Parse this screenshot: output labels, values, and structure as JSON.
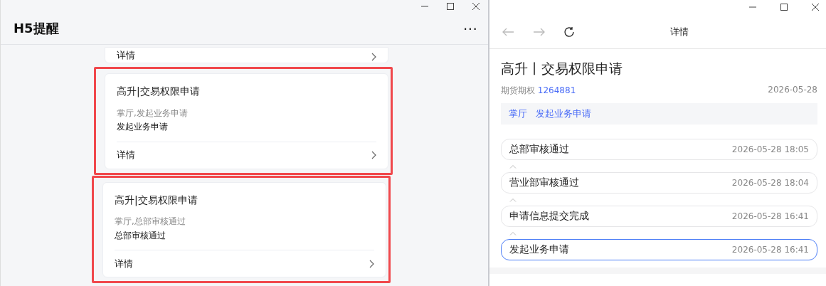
{
  "left_window": {
    "title": "H5提醒",
    "menu": "⋯",
    "cards": [
      {
        "kind": "partial",
        "link": "详情",
        "highlighted": false
      },
      {
        "kind": "full",
        "title": "高升|交易权限申请",
        "source": "掌厅,发起业务申请",
        "body": "发起业务申请",
        "link": "详情",
        "highlighted": true
      },
      {
        "kind": "full",
        "title": "高升|交易权限申请",
        "source": "掌厅,总部审核通过",
        "body": "总部审核通过",
        "link": "详情",
        "highlighted": true
      }
    ]
  },
  "right_window": {
    "page_title": "详情",
    "title": "高升丨交易权限申请",
    "category": "期货期权",
    "code": "1264881",
    "date": "2026-05-28",
    "tags": [
      "掌厅",
      "发起业务申请"
    ],
    "timeline": [
      {
        "label": "总部审核通过",
        "time": "2026-05-28 18:05",
        "selected": false
      },
      {
        "label": "营业部审核通过",
        "time": "2026-05-28 18:04",
        "selected": false
      },
      {
        "label": "申请信息提交完成",
        "time": "2026-05-28 16:41",
        "selected": false
      },
      {
        "label": "发起业务申请",
        "time": "2026-05-28 16:41",
        "selected": true
      }
    ]
  }
}
